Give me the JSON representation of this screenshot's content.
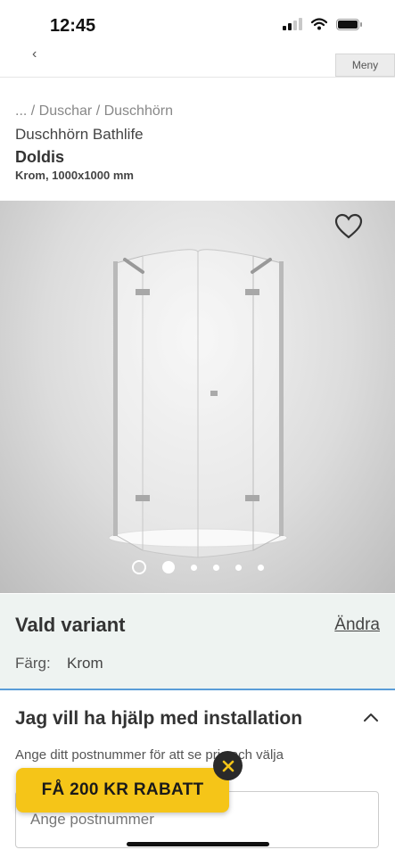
{
  "status_bar": {
    "time": "12:45"
  },
  "header": {
    "back_glyph": "‹",
    "menu_label": "Meny"
  },
  "product": {
    "breadcrumb": "... / Duschar / Duschhörn",
    "category": "Duschhörn Bathlife",
    "name": "Doldis",
    "spec": "Krom, 1000x1000 mm"
  },
  "gallery": {
    "icon": "heart-icon",
    "slide_count": 6,
    "active_index": 0
  },
  "variant": {
    "title": "Vald variant",
    "change_link": "Ändra",
    "color_label": "Färg:",
    "color_value": "Krom"
  },
  "installation": {
    "title": "Jag vill ha hjälp med installation",
    "description": "Ange ditt postnummer för att se pris och välja",
    "postal_placeholder": "Ange postnummer"
  },
  "discount_banner": {
    "text": "FÅ 200 KR RABATT",
    "close_icon": "close-icon"
  },
  "colors": {
    "accent_blue": "#5a9dd8",
    "banner_yellow": "#f5c518",
    "variant_background": "#eef3f1"
  }
}
